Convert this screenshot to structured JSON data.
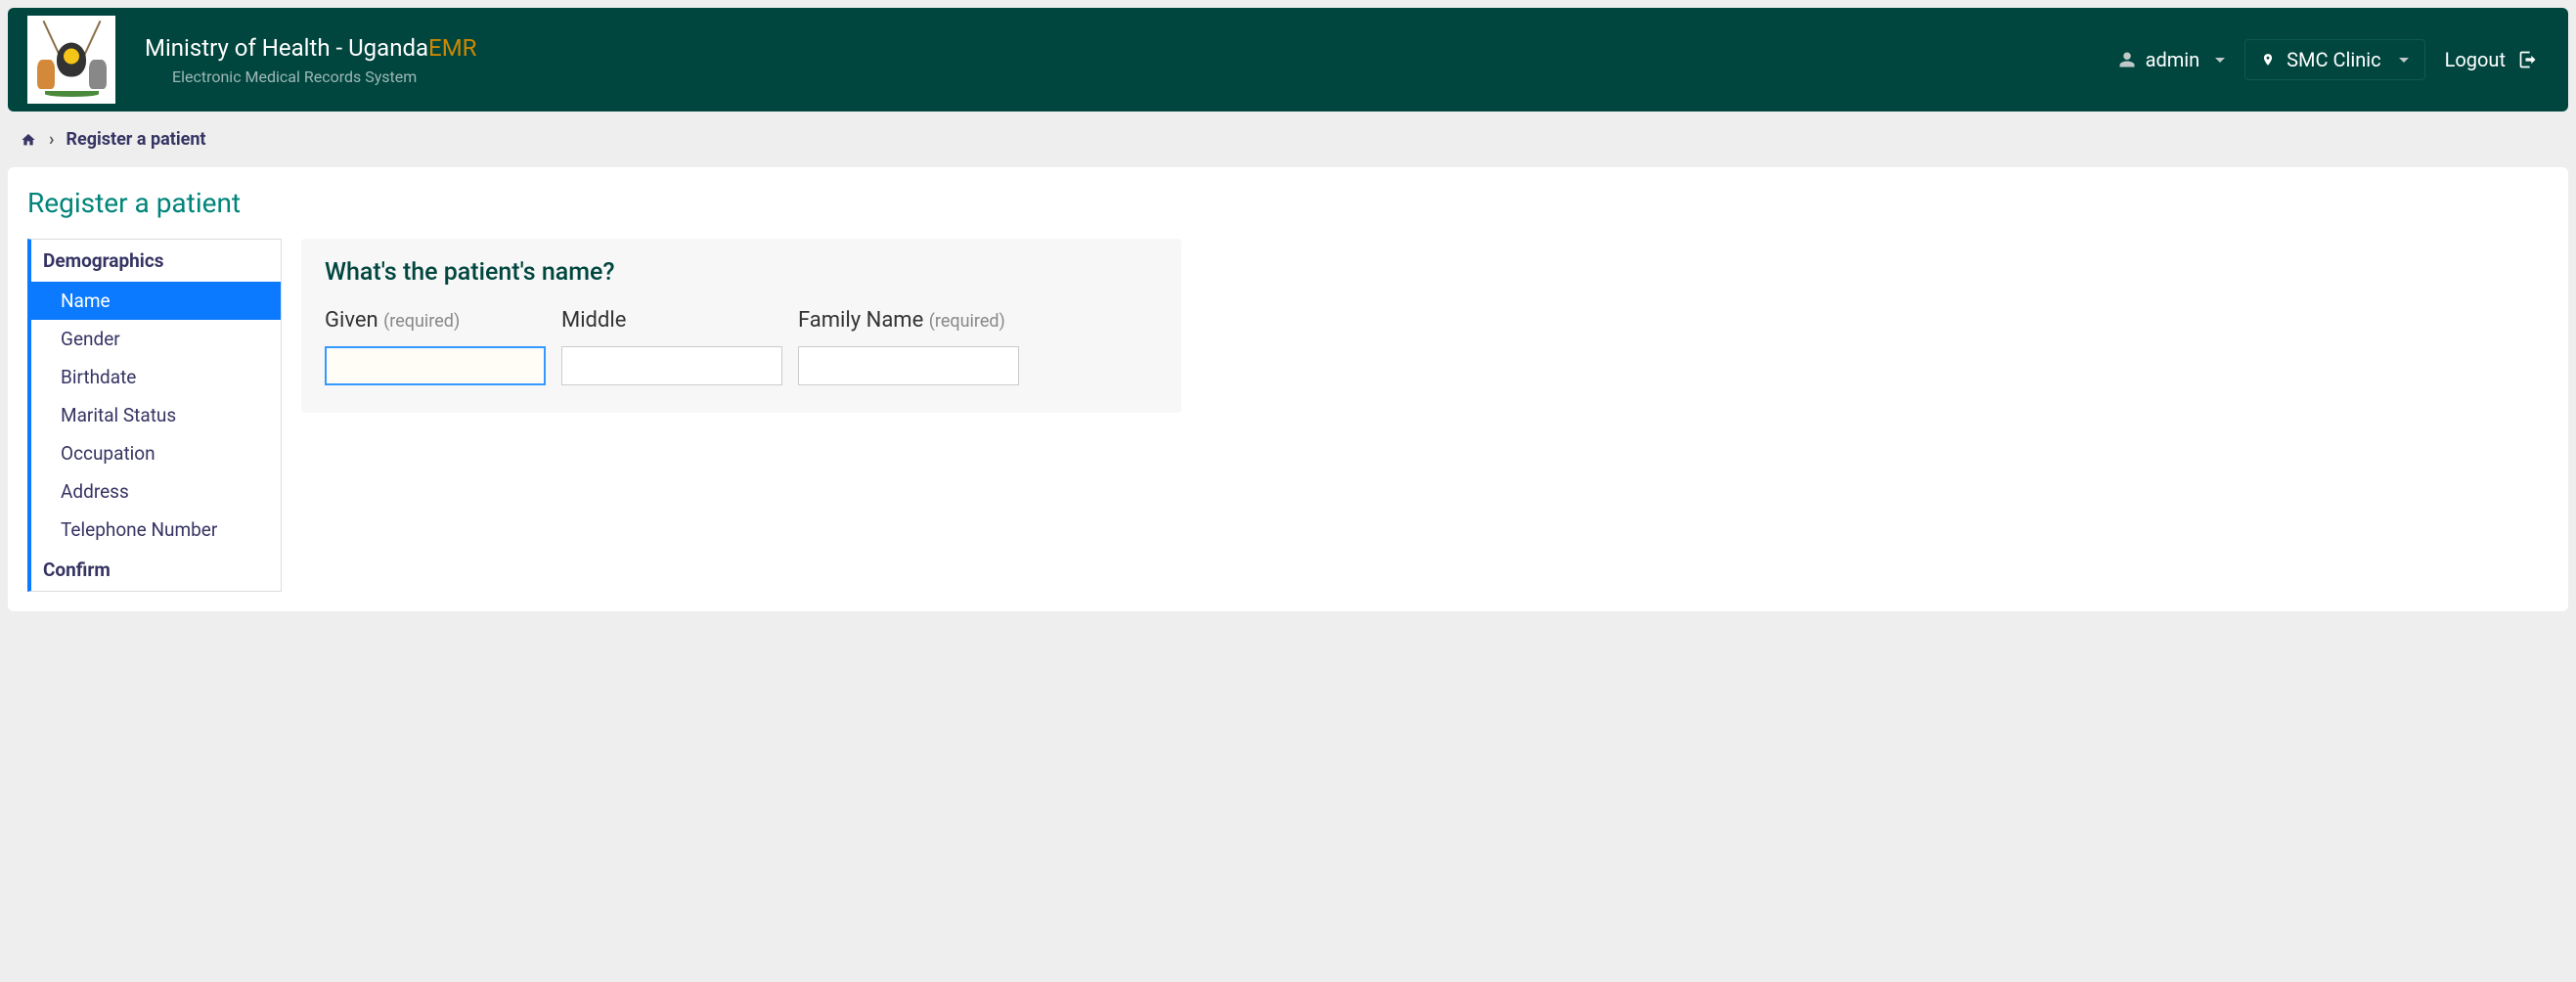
{
  "header": {
    "title_main": "Ministry of Health - Uganda",
    "title_suffix": "EMR",
    "subtitle": "Electronic Medical Records System",
    "user": "admin",
    "location": "SMC Clinic",
    "logout": "Logout"
  },
  "breadcrumb": {
    "current": "Register a patient"
  },
  "page": {
    "title": "Register a patient"
  },
  "sidebar": {
    "sections": [
      {
        "label": "Demographics",
        "items": [
          {
            "label": "Name",
            "active": true
          },
          {
            "label": "Gender",
            "active": false
          },
          {
            "label": "Birthdate",
            "active": false
          },
          {
            "label": "Marital Status",
            "active": false
          },
          {
            "label": "Occupation",
            "active": false
          },
          {
            "label": "Address",
            "active": false
          },
          {
            "label": "Telephone Number",
            "active": false
          }
        ]
      },
      {
        "label": "Confirm",
        "items": []
      }
    ]
  },
  "form": {
    "question": "What's the patient's name?",
    "given_label": "Given",
    "given_required": "(required)",
    "middle_label": "Middle",
    "family_label": "Family Name",
    "family_required": "(required)",
    "given_value": "",
    "middle_value": "",
    "family_value": ""
  }
}
